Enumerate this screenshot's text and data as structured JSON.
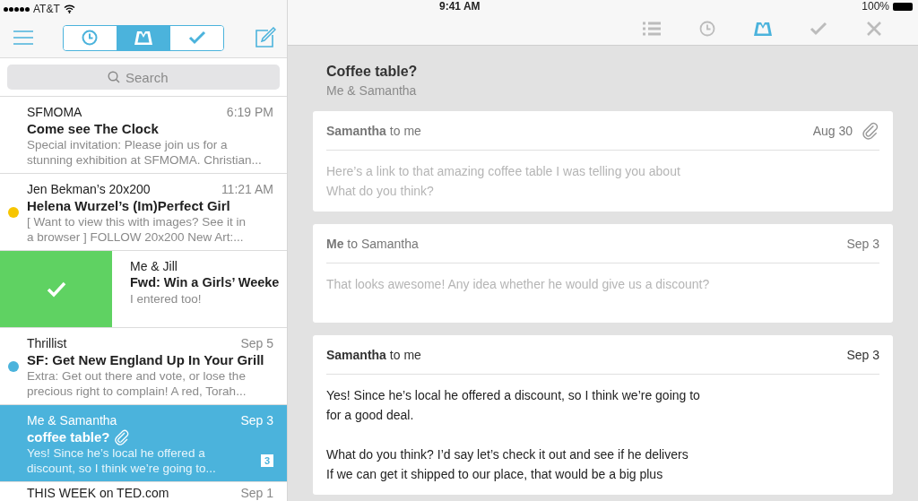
{
  "status_bar": {
    "carrier": "AT&T",
    "time": "9:41 AM",
    "battery": "100%"
  },
  "segments": [
    {
      "kind": "clock",
      "selected": false
    },
    {
      "kind": "tray",
      "selected": true
    },
    {
      "kind": "check",
      "selected": false
    }
  ],
  "search": {
    "placeholder": "Search"
  },
  "emails": [
    {
      "kind": "normal",
      "sender": "SFMOMA",
      "time": "6:19 PM",
      "subject": "Come see The Clock",
      "preview_lines": [
        "Special invitation: Please join us for a",
        "stunning exhibition at SFMOMA. Christian..."
      ],
      "selected": false,
      "attachment": false
    },
    {
      "kind": "normal",
      "sender": "Jen Bekman’s 20x200",
      "time": "11:21 AM",
      "subject": "Helena Wurzel’s (Im)Perfect Girl",
      "preview_lines": [
        "[ Want to view this with images? See it in",
        "a browser ] FOLLOW 20x200 New Art:..."
      ],
      "color": "#f7c500",
      "selected": false,
      "attachment": false
    },
    {
      "kind": "swiped",
      "sender": "Me & Jill",
      "subject": "Fwd: Win a Girls’ Weeke",
      "preview_lines": [
        "I entered too!"
      ],
      "selected": false,
      "attachment": false
    },
    {
      "kind": "normal",
      "sender": "Thrillist",
      "time": "Sep 5",
      "subject": "SF: Get New England Up In Your Grill",
      "preview_lines": [
        "Extra: Get out there and vote, or lose the",
        "precious right to complain! A red, Torah..."
      ],
      "color": "#4bb3dc",
      "selected": false,
      "attachment": false
    },
    {
      "kind": "normal",
      "sender": "Me & Samantha",
      "time": "Sep 3",
      "subject": "coffee table?",
      "preview_lines": [
        "Yes! Since he’s local he offered a",
        "discount, so I think we’re going to..."
      ],
      "selected": true,
      "attachment": true,
      "count": "3"
    },
    {
      "kind": "normal",
      "sender": "THIS WEEK on TED.com",
      "time": "Sep 1",
      "selected": false
    }
  ],
  "toolbar": [
    {
      "kind": "list",
      "selected": false
    },
    {
      "kind": "clock",
      "selected": false
    },
    {
      "kind": "tray",
      "selected": true
    },
    {
      "kind": "check",
      "selected": false
    },
    {
      "kind": "close",
      "selected": false
    }
  ],
  "thread": {
    "title": "Coffee table?",
    "participants": "Me & Samantha"
  },
  "messages": [
    {
      "kind": "collapsed",
      "from": "**Samantha** to me",
      "date": "Aug 30",
      "attachment": true,
      "paragraphs": [
        [
          "Here’s a link to that amazing coffee table I was telling you about",
          "What do you think?"
        ]
      ]
    },
    {
      "kind": "collapsed",
      "from": "**Me** to Samantha",
      "date": "Sep 3",
      "attachment": false,
      "paragraphs": [
        [
          "That looks awesome! Any idea whether he would give us a discount?"
        ]
      ]
    },
    {
      "kind": "expanded",
      "from": "**Samantha** to me",
      "date": "Sep 3",
      "attachment": false,
      "paragraphs": [
        [
          "Yes! Since he’s local he offered a discount, so I think we’re going to",
          "for a good deal."
        ],
        [
          "What do you think? I’d say let’s check it out and see if he delivers",
          "If we can get it shipped to our place, that would be a big plus"
        ]
      ]
    }
  ]
}
